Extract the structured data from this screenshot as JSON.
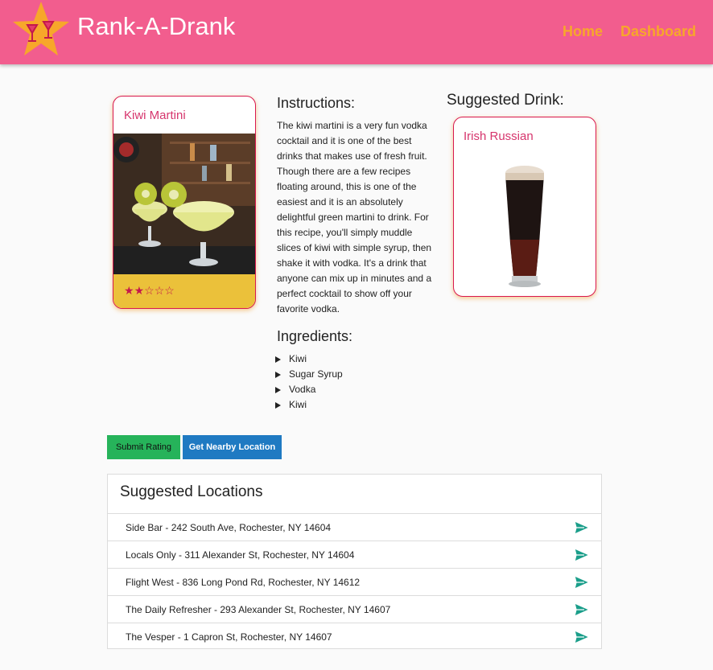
{
  "header": {
    "brand": "Rank-A-Drank",
    "nav": {
      "home": "Home",
      "dashboard": "Dashboard"
    }
  },
  "drink": {
    "name": "Kiwi Martini",
    "rating": {
      "value": 2,
      "max": 5
    }
  },
  "instructions": {
    "heading": "Instructions:",
    "text": "The kiwi martini is a very fun vodka cocktail and it is one of the best drinks that makes use of fresh fruit. Though there are a few recipes floating around, this is one of the easiest and it is an absolutely delightful green martini to drink. For this recipe, you'll simply muddle slices of kiwi with simple syrup, then shake it with vodka. It's a drink that anyone can mix up in minutes and a perfect cocktail to show off your favorite vodka."
  },
  "ingredients": {
    "heading": "Ingredients:",
    "items": [
      "Kiwi",
      "Sugar Syrup",
      "Vodka",
      "Kiwi"
    ]
  },
  "suggested_drink": {
    "heading": "Suggested Drink:",
    "name": "Irish Russian"
  },
  "buttons": {
    "submit": "Submit Rating",
    "nearby": "Get Nearby Location"
  },
  "locations": {
    "heading": "Suggested Locations",
    "items": [
      "Side Bar - 242 South Ave, Rochester, NY 14604",
      "Locals Only - 311 Alexander St, Rochester, NY 14604",
      "Flight West - 836 Long Pond Rd, Rochester, NY 14612",
      "The Daily Refresher - 293 Alexander St, Rochester, NY 14607",
      "The Vesper - 1 Capron St, Rochester, NY 14607"
    ]
  },
  "colors": {
    "header": "#f25d8e",
    "nav": "#f7a72a",
    "card_border": "#d8184f",
    "card_title": "#d6356d",
    "card_footer": "#ebc13a",
    "star": "#c4184c",
    "submit_button": "#26b35a",
    "nearby_button": "#1f7ac2",
    "send_arrow": "#1a9e8a"
  },
  "icons": {
    "logo": "cocktail-star-icon",
    "rating": "star-icon",
    "location_action": "send-arrow-icon",
    "ingredient_bullet": "triangle-bullet-icon"
  }
}
